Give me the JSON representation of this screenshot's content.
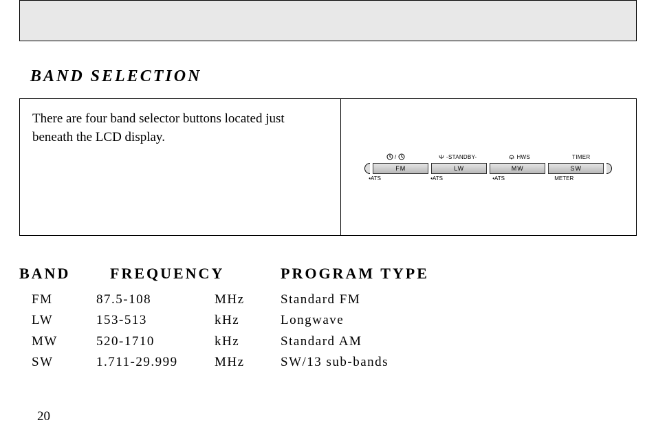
{
  "section_title": "BAND SELECTION",
  "description": "There are four band selector buttons located just beneath the LCD display.",
  "figure": {
    "top_labels": {
      "clock": "⏲/⏲",
      "standby": "-STANDBY-",
      "hws": "HWS",
      "timer": "TIMER"
    },
    "buttons": [
      "FM",
      "LW",
      "MW",
      "SW"
    ],
    "bottom_labels": [
      "•ATS",
      "•ATS",
      "•ATS",
      "METER"
    ]
  },
  "table": {
    "headers": {
      "band": "BAND",
      "frequency": "FREQUENCY",
      "program": "PROGRAM TYPE"
    },
    "rows": [
      {
        "band": "FM",
        "freq": "87.5-108",
        "unit": "MHz",
        "program": "Standard FM"
      },
      {
        "band": "LW",
        "freq": "153-513",
        "unit": "kHz",
        "program": "Longwave"
      },
      {
        "band": "MW",
        "freq": "520-1710",
        "unit": "kHz",
        "program": "Standard AM"
      },
      {
        "band": "SW",
        "freq": "1.711-29.999",
        "unit": "MHz",
        "program": "SW/13 sub-bands"
      }
    ]
  },
  "page_number": "20"
}
